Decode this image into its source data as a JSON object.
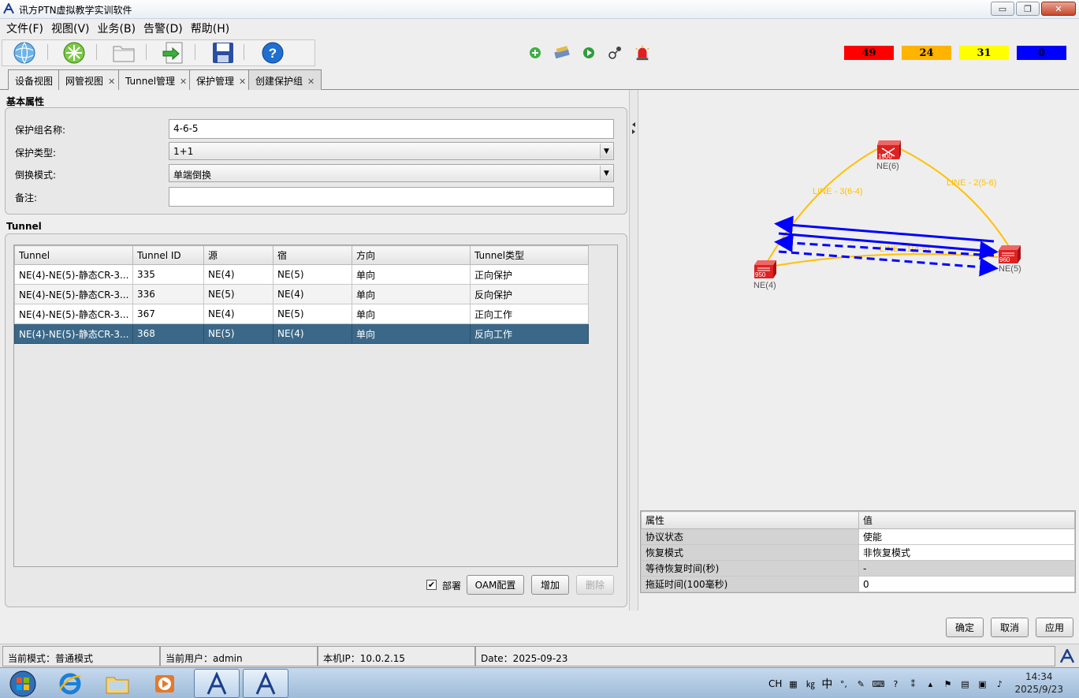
{
  "window": {
    "title": "讯方PTN虚拟教学实训软件",
    "buttons": {
      "minimize": "▭",
      "maximize": "❐",
      "close": "✕"
    }
  },
  "menu": [
    {
      "label": "文件(F)"
    },
    {
      "label": "视图(V)"
    },
    {
      "label": "业务(B)"
    },
    {
      "label": "告警(D)"
    },
    {
      "label": "帮助(H)"
    }
  ],
  "toolbar": {
    "icons": [
      "globe-icon",
      "network-icon",
      "folder-icon",
      "export-icon",
      "save-icon",
      "help-icon"
    ],
    "mini_icons": [
      "add-icon",
      "config-icon",
      "play-icon",
      "user-link-icon",
      "alarm-light-icon"
    ],
    "alarms": [
      {
        "count": "49",
        "color": "#ff0000"
      },
      {
        "count": "24",
        "color": "#ffb400"
      },
      {
        "count": "31",
        "color": "#ffff00"
      },
      {
        "count": "0",
        "color": "#0000ff"
      }
    ]
  },
  "tabs": [
    {
      "label": "设备视图",
      "closable": false
    },
    {
      "label": "网管视图",
      "closable": true
    },
    {
      "label": "Tunnel管理",
      "closable": true
    },
    {
      "label": "保护管理",
      "closable": true
    },
    {
      "label": "创建保护组",
      "closable": true
    }
  ],
  "basic": {
    "section_title": "基本属性",
    "name_label": "保护组名称:",
    "name_value": "4-6-5",
    "type_label": "保护类型:",
    "type_value": "1+1",
    "switch_label": "倒换模式:",
    "switch_value": "单端倒换",
    "note_label": "备注:",
    "note_value": ""
  },
  "tunnel": {
    "section_title": "Tunnel",
    "columns": [
      "Tunnel",
      "Tunnel ID",
      "源",
      "宿",
      "方向",
      "Tunnel类型"
    ],
    "rows": [
      {
        "tunnel": "NE(4)-NE(5)-静态CR-3...",
        "id": "335",
        "src": "NE(4)",
        "dst": "NE(5)",
        "dir": "单向",
        "type": "正向保护"
      },
      {
        "tunnel": "NE(4)-NE(5)-静态CR-3...",
        "id": "336",
        "src": "NE(5)",
        "dst": "NE(4)",
        "dir": "单向",
        "type": "反向保护"
      },
      {
        "tunnel": "NE(4)-NE(5)-静态CR-3...",
        "id": "367",
        "src": "NE(4)",
        "dst": "NE(5)",
        "dir": "单向",
        "type": "正向工作"
      },
      {
        "tunnel": "NE(4)-NE(5)-静态CR-3...",
        "id": "368",
        "src": "NE(5)",
        "dst": "NE(4)",
        "dir": "单向",
        "type": "反向工作"
      }
    ],
    "selected_row": 3,
    "deploy_label": "部署",
    "deploy_checked": true,
    "oam_label": "OAM配置",
    "add_label": "增加",
    "delete_label": "删除"
  },
  "topology": {
    "nodes": [
      {
        "id": "NE(6)",
        "model": "1900"
      },
      {
        "id": "NE(4)",
        "model": "950"
      },
      {
        "id": "NE(5)",
        "model": "960"
      }
    ],
    "links": [
      {
        "label": "LINE - 3(6-4)"
      },
      {
        "label": "LINE - 2(5-6)"
      },
      {
        "label": "LINE - 1(4-5)"
      }
    ],
    "link_color": "#ffc000",
    "tunnel_color": "#0000ff"
  },
  "properties": {
    "columns": [
      "属性",
      "值"
    ],
    "rows": [
      {
        "key": "协议状态",
        "value": "使能"
      },
      {
        "key": "恢复模式",
        "value": "非恢复模式"
      },
      {
        "key": "等待恢复时间(秒)",
        "value": "-"
      },
      {
        "key": "拖延时间(100毫秒)",
        "value": "0"
      }
    ]
  },
  "dialog_buttons": {
    "ok": "确定",
    "cancel": "取消",
    "apply": "应用"
  },
  "status": {
    "mode": "当前模式：普通模式",
    "user": "当前用户：admin",
    "ip": "本机IP：10.0.2.15",
    "date": "Date：2025-09-23"
  },
  "taskbar": {
    "ime": "CH",
    "ime_mode": "中",
    "time": "14:34",
    "date": "2025/9/23"
  }
}
